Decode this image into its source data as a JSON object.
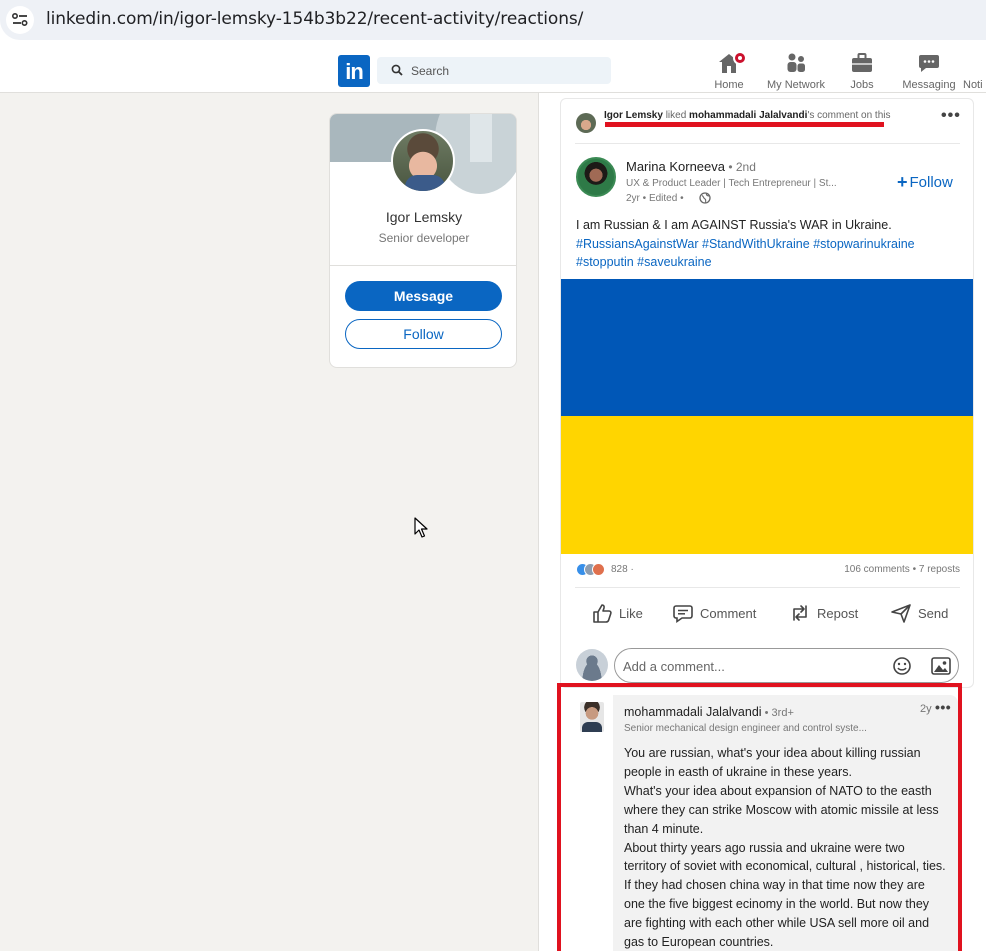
{
  "browser": {
    "url": "linkedin.com/in/igor-lemsky-154b3b22/recent-activity/reactions/"
  },
  "nav": {
    "logo": "in",
    "search_placeholder": "Search",
    "items": [
      {
        "label": "Home",
        "icon": "home-icon",
        "has_badge": true
      },
      {
        "label": "My Network",
        "icon": "people-icon"
      },
      {
        "label": "Jobs",
        "icon": "briefcase-icon"
      },
      {
        "label": "Messaging",
        "icon": "chat-icon"
      },
      {
        "label": "Noti",
        "icon": "bell-icon"
      }
    ]
  },
  "profile": {
    "name": "Igor Lemsky",
    "title": "Senior developer",
    "message_label": "Message",
    "follow_label": "Follow"
  },
  "activity": {
    "actor": "Igor Lemsky",
    "verb": " liked ",
    "target": "mohammadali Jalalvandi",
    "suffix": "'s comment on this"
  },
  "post": {
    "author_name": "Marina Korneeva",
    "author_degree": " • 2nd",
    "author_headline": "UX & Product Leader | Tech Entrepreneur | St...",
    "meta": "2yr • Edited •",
    "follow_label": "Follow",
    "text_line1": "I am Russian & I am AGAINST Russia's WAR in Ukraine.",
    "hashtags": [
      "#RussiansAgainstWar",
      "#StandWithUkraine",
      "#stopwarinukraine",
      "#stopputin",
      "#saveukraine"
    ],
    "flag_colors": {
      "top": "#0057b7",
      "bottom": "#ffd500"
    },
    "reaction_count": "828 ·",
    "comments_reposts": "106 comments • 7 reposts",
    "actions": {
      "like": "Like",
      "comment": "Comment",
      "repost": "Repost",
      "send": "Send"
    },
    "comment_placeholder": "Add a comment..."
  },
  "comment": {
    "author_name": "mohammadali Jalalvandi",
    "author_degree": " • 3rd+",
    "time": "2y",
    "headline": "Senior mechanical design engineer and control syste...",
    "lines": [
      "You are russian, what's your idea about killing russian people in easth of ukraine in these years.",
      "What's your idea about expansion of NATO to the easth where they can strike Moscow with atomic missile at less than 4 minute.",
      "About thirty years ago russia and ukraine were two territory of soviet with economical, cultural , historical, ties. If they had chosen china way in that time now they are one the five biggest ecinomy in the world. But now they are fighting with each other while USA sell more oil and gas to European countries."
    ]
  },
  "colors": {
    "brand": "#0a66c2",
    "highlight": "#e0121f"
  }
}
